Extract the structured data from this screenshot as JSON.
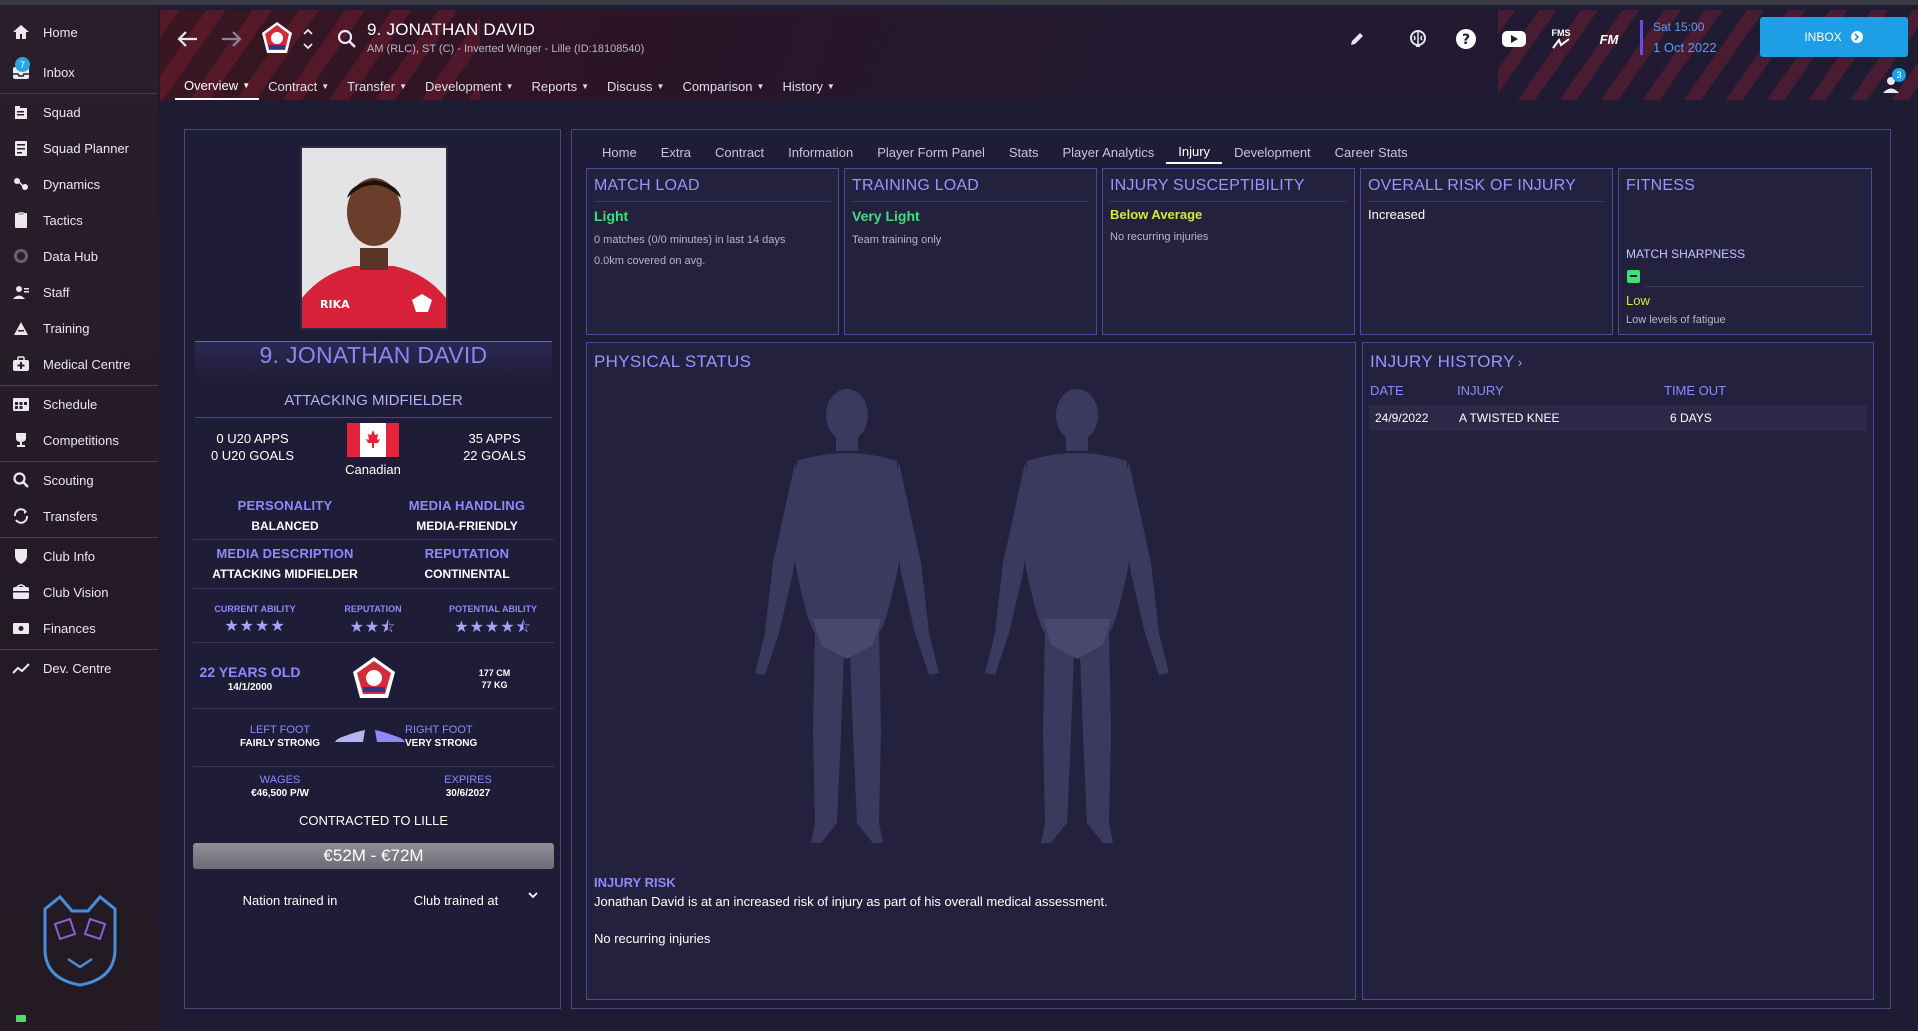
{
  "sidebar": {
    "items": [
      {
        "label": "Home",
        "icon": "home-icon"
      },
      {
        "label": "Inbox",
        "icon": "inbox-icon",
        "badge": "7"
      },
      {
        "label": "Squad",
        "icon": "squad-icon"
      },
      {
        "label": "Squad Planner",
        "icon": "planner-icon"
      },
      {
        "label": "Dynamics",
        "icon": "dynamics-icon"
      },
      {
        "label": "Tactics",
        "icon": "tactics-icon"
      },
      {
        "label": "Data Hub",
        "icon": "data-hub-icon"
      },
      {
        "label": "Staff",
        "icon": "staff-icon"
      },
      {
        "label": "Training",
        "icon": "training-icon"
      },
      {
        "label": "Medical Centre",
        "icon": "medical-icon"
      },
      {
        "label": "Schedule",
        "icon": "schedule-icon"
      },
      {
        "label": "Competitions",
        "icon": "trophy-icon"
      },
      {
        "label": "Scouting",
        "icon": "scouting-icon"
      },
      {
        "label": "Transfers",
        "icon": "transfers-icon"
      },
      {
        "label": "Club Info",
        "icon": "club-info-icon"
      },
      {
        "label": "Club Vision",
        "icon": "club-vision-icon"
      },
      {
        "label": "Finances",
        "icon": "finances-icon"
      },
      {
        "label": "Dev. Centre",
        "icon": "dev-centre-icon"
      }
    ]
  },
  "header": {
    "title": "9. JONATHAN DAVID",
    "subtitle": "AM (RLC), ST (C) - Inverted Winger - Lille (ID:18108540)",
    "date_day": "Sat 15:00",
    "date_full": "1 Oct 2022",
    "inbox_label": "INBOX",
    "fm_label": "FM",
    "fms_label": "FMS",
    "notification_count": "3",
    "tabs": [
      {
        "label": "Overview",
        "active": true
      },
      {
        "label": "Contract"
      },
      {
        "label": "Transfer"
      },
      {
        "label": "Development"
      },
      {
        "label": "Reports"
      },
      {
        "label": "Discuss"
      },
      {
        "label": "Comparison"
      },
      {
        "label": "History"
      }
    ],
    "colors": {
      "accent": "#1e9fe5",
      "date": "#5a9cf0"
    }
  },
  "player": {
    "name": "9. JONATHAN DAVID",
    "position": "ATTACKING MIDFIELDER",
    "u20_apps": "0 U20 APPS",
    "u20_goals": "0 U20 GOALS",
    "nationality": "Canadian",
    "apps": "35 APPS",
    "goals": "22 GOALS",
    "personality_label": "PERSONALITY",
    "personality": "BALANCED",
    "media_handling_label": "MEDIA HANDLING",
    "media_handling": "MEDIA-FRIENDLY",
    "media_description_label": "MEDIA DESCRIPTION",
    "media_description": "ATTACKING MIDFIELDER",
    "reputation_label": "REPUTATION",
    "reputation": "CONTINENTAL",
    "current_ability_label": "CURRENT ABILITY",
    "current_ability_stars": "★★★★",
    "reputation_small_label": "REPUTATION",
    "reputation_stars": "★★⯪",
    "potential_ability_label": "POTENTIAL ABILITY",
    "potential_ability_stars": "★★★★⯪",
    "age": "22 YEARS OLD",
    "dob": "14/1/2000",
    "height": "177 CM",
    "weight": "77 KG",
    "left_foot_label": "LEFT FOOT",
    "left_foot": "FAIRLY STRONG",
    "right_foot_label": "RIGHT FOOT",
    "right_foot": "VERY STRONG",
    "wages_label": "WAGES",
    "wages": "€46,500 P/W",
    "expires_label": "EXPIRES",
    "expires": "30/6/2027",
    "contracted": "CONTRACTED TO LILLE",
    "value": "€52M - €72M",
    "nation_trained": "Nation trained in",
    "club_trained": "Club trained at",
    "shirt_sponsor": "RIKA"
  },
  "subtabs": [
    {
      "label": "Home"
    },
    {
      "label": "Extra"
    },
    {
      "label": "Contract"
    },
    {
      "label": "Information"
    },
    {
      "label": "Player Form Panel"
    },
    {
      "label": "Stats"
    },
    {
      "label": "Player Analytics"
    },
    {
      "label": "Injury",
      "active": true
    },
    {
      "label": "Development"
    },
    {
      "label": "Career Stats"
    }
  ],
  "cards": {
    "match_load": {
      "title": "MATCH LOAD",
      "value": "Light",
      "line1": "0 matches (0/0 minutes) in last 14 days",
      "line2": "0.0km covered on avg."
    },
    "training_load": {
      "title": "TRAINING LOAD",
      "value": "Very Light",
      "line1": "Team training only"
    },
    "susceptibility": {
      "title": "INJURY SUSCEPTIBILITY",
      "value": "Below Average",
      "line1": "No recurring injuries"
    },
    "overall_risk": {
      "title": "OVERALL RISK OF INJURY",
      "value": "Increased"
    },
    "fitness": {
      "title": "FITNESS",
      "sharpness_label": "MATCH SHARPNESS",
      "value": "Low",
      "line1": "Low levels of fatigue"
    }
  },
  "physical": {
    "title": "PHYSICAL STATUS",
    "risk_label": "INJURY RISK",
    "risk_text": "Jonathan David is at an increased risk of injury as part of his overall medical assessment.",
    "recurring": "No recurring injuries"
  },
  "history": {
    "title": "INJURY HISTORY",
    "columns": [
      "DATE",
      "INJURY",
      "TIME OUT"
    ],
    "rows": [
      {
        "date": "24/9/2022",
        "injury": "A TWISTED KNEE",
        "time_out": "6 DAYS"
      }
    ]
  },
  "colors": {
    "green_value": "#3ee07a",
    "yellow_value": "#d6e83c",
    "accent_purple": "#9b93ff"
  }
}
